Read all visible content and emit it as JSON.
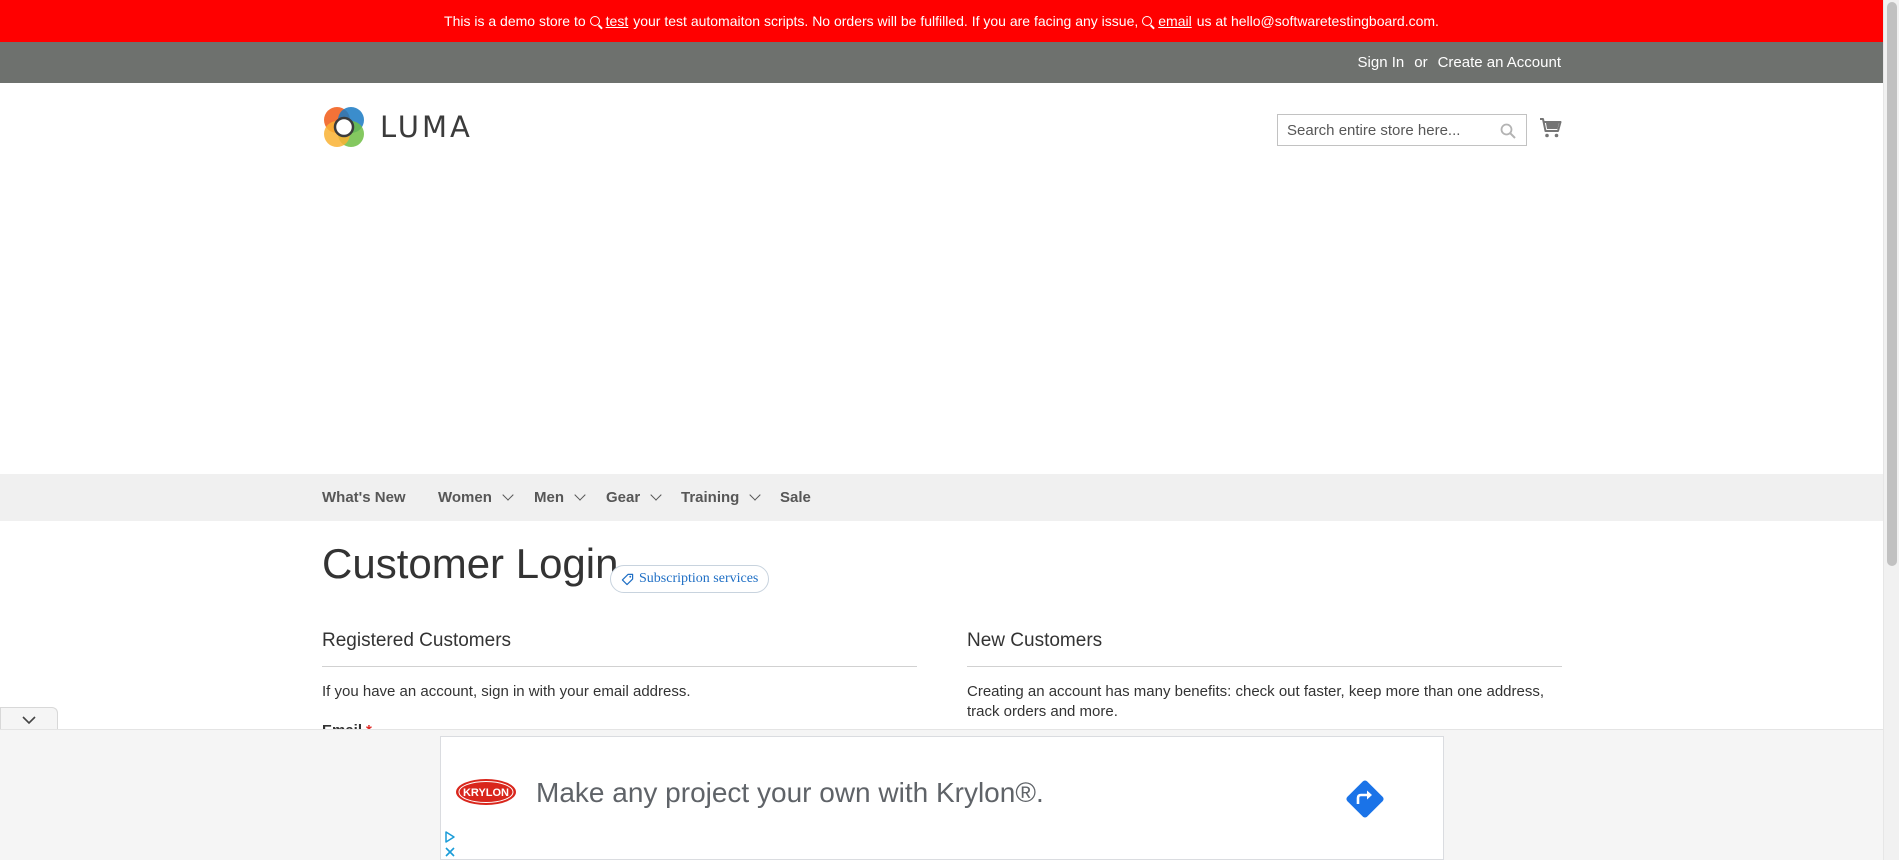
{
  "notice": {
    "part1": "This is a demo store to",
    "link1": "test",
    "part2": "your test automaiton scripts. No orders will be fulfilled. If you are facing any issue,",
    "link2": "email",
    "part3": "us at hello@softwaretestingboard.com."
  },
  "header": {
    "sign_in": "Sign In",
    "or": "or",
    "create_account": "Create an Account",
    "logo_text": "LUMA",
    "search_placeholder": "Search entire store here..."
  },
  "nav": {
    "items": [
      {
        "label": "What's New",
        "has_dropdown": false
      },
      {
        "label": "Women",
        "has_dropdown": true
      },
      {
        "label": "Men",
        "has_dropdown": true
      },
      {
        "label": "Gear",
        "has_dropdown": true
      },
      {
        "label": "Training",
        "has_dropdown": true
      },
      {
        "label": "Sale",
        "has_dropdown": false
      }
    ]
  },
  "main": {
    "title": "Customer Login",
    "badge": "Subscription services",
    "registered": {
      "title": "Registered Customers",
      "text": "If you have an account, sign in with your email address.",
      "email_label": "Email",
      "required_mark": "*"
    },
    "new_customers": {
      "title": "New Customers",
      "text": "Creating an account has many benefits: check out faster, keep more than one address, track orders and more."
    }
  },
  "ad": {
    "brand": "KRYLON",
    "text": "Make any project your own with Krylon®."
  },
  "colors": {
    "notice_bg": "#ff0000",
    "panel_bg": "#6e716e",
    "nav_bg": "#f0f0f0",
    "link_blue": "#1f6fc5",
    "ad_cta": "#1a73e8"
  },
  "icons": [
    "magnifier-icon",
    "search-icon",
    "cart-icon",
    "chevron-down-icon",
    "tag-icon",
    "ad-choices-icon",
    "close-icon",
    "arrow-right-icon",
    "luma-logo-icon"
  ]
}
